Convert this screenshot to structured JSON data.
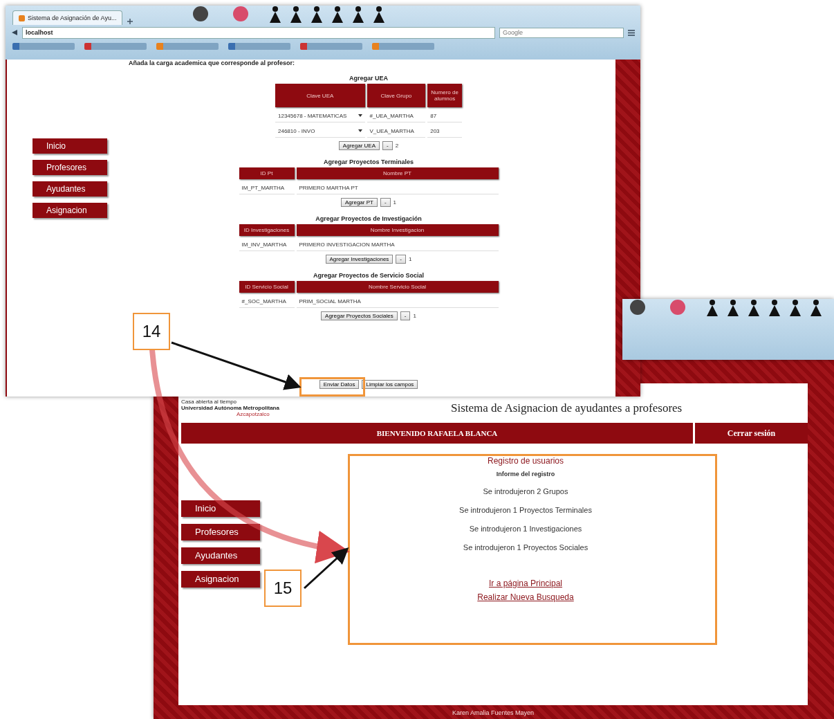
{
  "back_window": {
    "tab_title": "Sistema de Asignación de Ayu...",
    "address": "localhost",
    "search_placeholder": "Google",
    "heading": "Añada la carga academica que corresponde al profesor:",
    "nav": [
      "Inicio",
      "Profesores",
      "Ayudantes",
      "Asignacion"
    ],
    "sections": [
      {
        "title": "Agregar UEA",
        "columns": [
          "Clave UEA",
          "Clave Grupo",
          "Numero de alumnos"
        ],
        "rows": [
          [
            {
              "kind": "select",
              "value": "12345678 - MATEMATICAS"
            },
            {
              "kind": "field",
              "value": "#_UEA_MARTHA"
            },
            {
              "kind": "field",
              "value": "87"
            }
          ],
          [
            {
              "kind": "select",
              "value": "246810 - INVO"
            },
            {
              "kind": "field",
              "value": "V_UEA_MARTHA"
            },
            {
              "kind": "field",
              "value": "203"
            }
          ]
        ],
        "add_button": "Agregar UEA",
        "minus_button": "-",
        "count": "2"
      },
      {
        "title": "Agregar Proyectos Terminales",
        "columns": [
          "ID Pt",
          "Nombre PT"
        ],
        "rows": [
          [
            {
              "kind": "field",
              "value": "IM_PT_MARTHA"
            },
            {
              "kind": "field",
              "value": "PRIMERO MARTHA PT"
            }
          ]
        ],
        "add_button": "Agregar PT",
        "minus_button": "-",
        "count": "1"
      },
      {
        "title": "Agregar Proyectos de Investigación",
        "columns": [
          "ID Investigaciones",
          "Nombre Investigacion"
        ],
        "rows": [
          [
            {
              "kind": "field",
              "value": "IM_INV_MARTHA"
            },
            {
              "kind": "field",
              "value": "PRIMERO INVESTIGACION MARTHA"
            }
          ]
        ],
        "add_button": "Agregar Investigaciones",
        "minus_button": "-",
        "count": "1"
      },
      {
        "title": "Agregar Proyectos de Servicio Social",
        "columns": [
          "ID Servicio Social",
          "Nombre Servicio Social"
        ],
        "rows": [
          [
            {
              "kind": "field",
              "value": "#_SOC_MARTHA"
            },
            {
              "kind": "field",
              "value": "PRIM_SOCIAL MARTHA"
            }
          ]
        ],
        "add_button": "Agregar Proyectos Sociales",
        "minus_button": "-",
        "count": "1"
      }
    ],
    "buttons": [
      "Enviar Datos",
      "Limpiar los campos"
    ]
  },
  "front_window": {
    "logo_lines": [
      "Casa abierta al tiempo",
      "Universidad Autónoma Metropolitana",
      "Azcapotzalco"
    ],
    "site_title": "Sistema de Asignacion de ayudantes a profesores",
    "welcome": "BIENVENIDO RAFAELA BLANCA",
    "logout": "Cerrar sesión",
    "nav": [
      "Inicio",
      "Profesores",
      "Ayudantes",
      "Asignacion"
    ],
    "report": {
      "title": "Registro de usuarios",
      "subtitle": "Informe del registro",
      "lines": [
        "Se introdujeron 2 Grupos",
        "Se introdujeron 1 Proyectos Terminales",
        "Se introdujeron 1 Investigaciones",
        "Se introdujeron 1 Proyectos Sociales"
      ],
      "links": [
        "Ir a página Principal",
        "Realizar Nueva Busqueda"
      ]
    },
    "footer": "Karen Amalia Fuentes Mayen"
  },
  "callouts": [
    "14",
    "15"
  ]
}
